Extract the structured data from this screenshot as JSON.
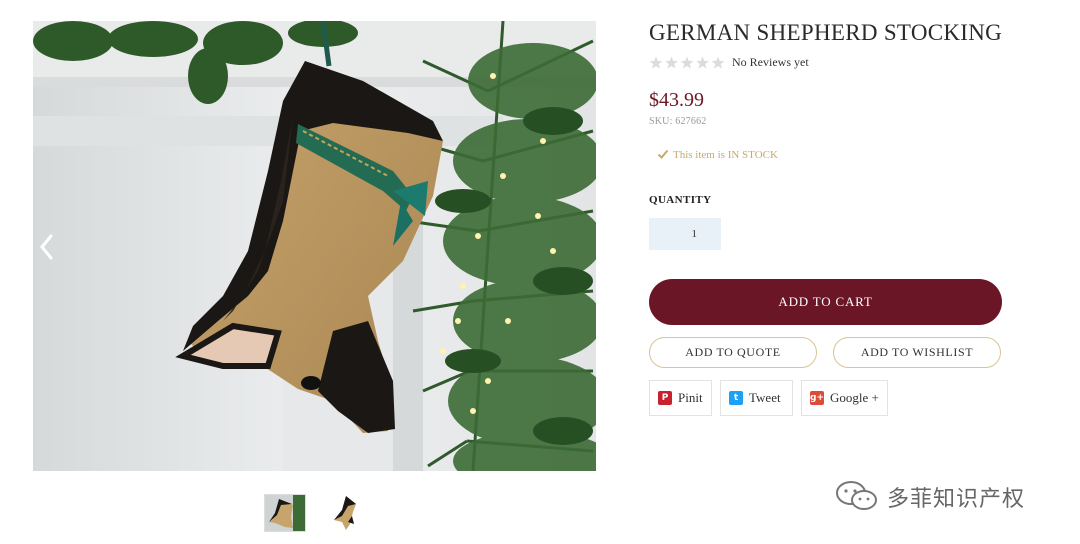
{
  "product": {
    "title": "GERMAN SHEPHERD STOCKING",
    "rating": {
      "stars": 0,
      "max_stars": 5,
      "reviews_text": "No Reviews yet"
    },
    "price": "$43.99",
    "sku": "SKU: 627662",
    "stock": {
      "text": "This item is IN STOCK",
      "icon": "check-icon"
    }
  },
  "quantity": {
    "label": "QUANTITY",
    "value": "1"
  },
  "actions": {
    "add_to_cart": "ADD TO CART",
    "add_to_quote": "ADD TO QUOTE",
    "add_to_wishlist": "ADD TO WISHLIST"
  },
  "share": [
    {
      "label": "Pinit",
      "icon": "pinterest-icon"
    },
    {
      "label": "Tweet",
      "icon": "twitter-icon"
    },
    {
      "label": "Google +",
      "icon": "google-plus-icon"
    }
  ],
  "gallery": {
    "prev_icon": "chevron-left-icon",
    "thumbnail_count": 2
  },
  "watermark": {
    "text": "多菲知识产权"
  },
  "colors": {
    "accent": "#6b1626",
    "price": "#6e1725",
    "stock": "#c8a96a",
    "button_border": "#d8c58f",
    "quantity_bg": "#e8f0f8"
  }
}
